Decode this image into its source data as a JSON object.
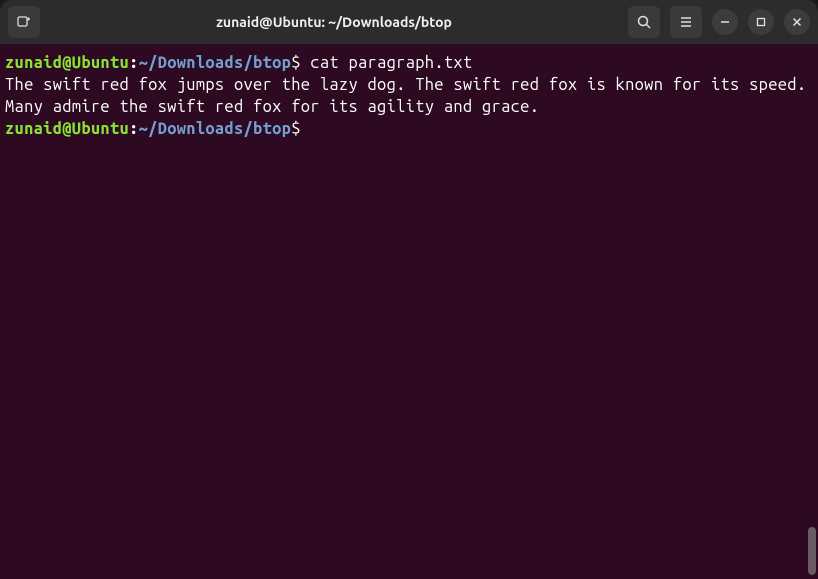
{
  "titlebar": {
    "title": "zunaid@Ubuntu: ~/Downloads/btop"
  },
  "terminal": {
    "prompt1": {
      "user": "zunaid@Ubuntu",
      "colon": ":",
      "path": "~/Downloads/btop",
      "dollar": "$",
      "command": " cat paragraph.txt"
    },
    "output": "The swift red fox jumps over the lazy dog. The swift red fox is known for its speed. Many admire the swift red fox for its agility and grace.",
    "prompt2": {
      "user": "zunaid@Ubuntu",
      "colon": ":",
      "path": "~/Downloads/btop",
      "dollar": "$",
      "command": " "
    }
  }
}
